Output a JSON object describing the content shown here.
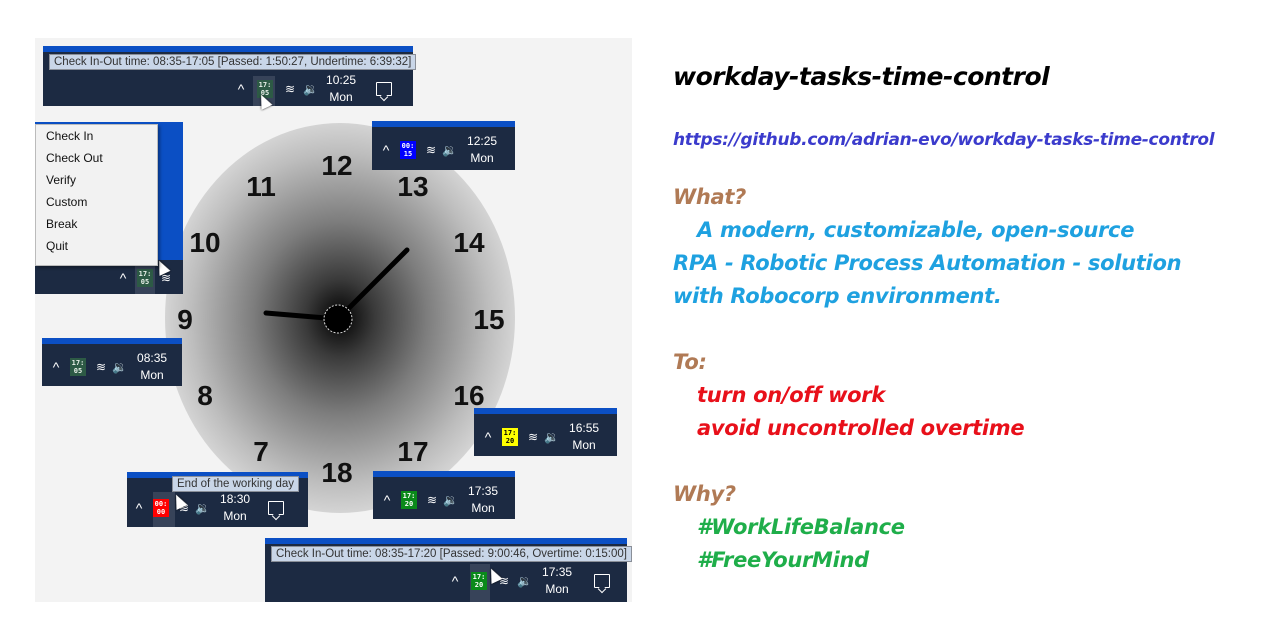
{
  "colors": {
    "taskbar_bg": "#1c2a42",
    "taskbar_accent": "#0b4fc4",
    "badge_default_bg": "#2d5a45",
    "badge_break_bg": "#0000ff",
    "badge_warning_bg": "#ffff00",
    "badge_overtime_bg": "#0a8a1a",
    "badge_end_bg": "#ff0000",
    "title_color": "#000000",
    "url_color": "#3b3bcc",
    "heading_color": "#b07a55",
    "what_color": "#1ea1e0",
    "to_color": "#e8101a",
    "why_color": "#1fae4a"
  },
  "clock": {
    "numbers": [
      "12",
      "13",
      "14",
      "15",
      "16",
      "17",
      "18",
      "7",
      "8",
      "9",
      "10",
      "11"
    ]
  },
  "tray_icons": {
    "chevron": "chevron-up-icon",
    "wifi": "wifi-icon",
    "volume": "volume-icon",
    "notifications": "notification-icon"
  },
  "taskbars": [
    {
      "id": "top",
      "tooltip": "Check In-Out time: 08:35-17:05 [Passed: 1:50:27, Undertime: 6:39:32]",
      "badge_top": "17:",
      "badge_bottom": "05",
      "time": "10:25",
      "day": "Mon"
    },
    {
      "id": "menu",
      "badge_top": "17:",
      "badge_bottom": "05"
    },
    {
      "id": "break",
      "badge_top": "00:",
      "badge_bottom": "15",
      "time": "12:25",
      "day": "Mon"
    },
    {
      "id": "start",
      "badge_top": "17:",
      "badge_bottom": "05",
      "time": "08:35",
      "day": "Mon"
    },
    {
      "id": "warning",
      "badge_top": "17:",
      "badge_bottom": "20",
      "time": "16:55",
      "day": "Mon"
    },
    {
      "id": "end",
      "tooltip": "End of the working day",
      "badge_top": "00:",
      "badge_bottom": "00",
      "time": "18:30",
      "day": "Mon"
    },
    {
      "id": "overtime",
      "badge_top": "17:",
      "badge_bottom": "20",
      "time": "17:35",
      "day": "Mon"
    },
    {
      "id": "bottom",
      "tooltip": "Check In-Out time: 08:35-17:20 [Passed: 9:00:46, Overtime: 0:15:00]",
      "badge_top": "17:",
      "badge_bottom": "20",
      "time": "17:35",
      "day": "Mon"
    }
  ],
  "context_menu": {
    "items": [
      "Check In",
      "Check Out",
      "Verify",
      "Custom",
      "Break",
      "Quit"
    ]
  },
  "description": {
    "title": "workday-tasks-time-control",
    "url": "https://github.com/adrian-evo/workday-tasks-time-control",
    "what_heading": "What?",
    "what_lines": [
      "A modern, customizable, open-source",
      "RPA - Robotic Process Automation - solution",
      "with Robocorp environment."
    ],
    "to_heading": "To:",
    "to_lines": [
      "turn on/off work",
      "avoid uncontrolled overtime"
    ],
    "why_heading": "Why?",
    "why_lines": [
      "#WorkLifeBalance",
      "#FreeYourMind"
    ]
  }
}
